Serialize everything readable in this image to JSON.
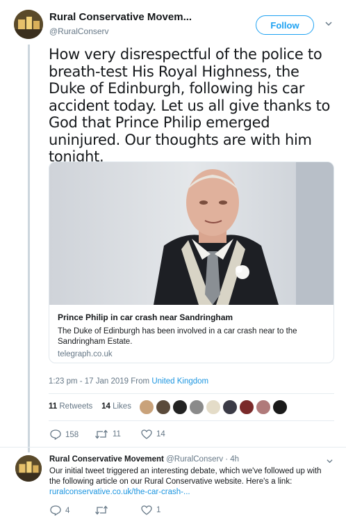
{
  "main_tweet": {
    "author_name": "Rural Conservative Movem...",
    "author_handle": "@RuralConserv",
    "follow_label": "Follow",
    "text": "How very disrespectful of the police to breath-test His Royal Highness, the Duke of Edinburgh, following his car accident today. Let us all give thanks to God that Prince Philip emerged uninjured. Our thoughts are with him tonight.",
    "card": {
      "title": "Prince Philip in car crash near Sandringham",
      "description": "The Duke of Edinburgh has been involved in a car crash near to the Sandringham Estate.",
      "domain": "telegraph.co.uk"
    },
    "timestamp": "1:23 pm - 17 Jan 2019 From",
    "location": "United Kingdom",
    "retweets_count": "11",
    "retweets_label": "Retweets",
    "likes_count": "14",
    "likes_label": "Likes",
    "actions": {
      "replies": "158",
      "retweets": "11",
      "likes": "14"
    }
  },
  "reply_tweet": {
    "author_name": "Rural Conservative Movement",
    "author_handle": "@RuralConserv · 4h",
    "text": "Our initial tweet triggered an interesting debate, which we've followed up with the following article on our Rural Conservative website. Here's a link:",
    "link": "ruralconservative.co.uk/the-car-crash-...",
    "actions": {
      "replies": "4",
      "retweets": "",
      "likes": "1"
    }
  },
  "colors": {
    "accent": "#1da1f2",
    "like_red": "#e0245e",
    "muted": "#657786"
  },
  "icons": [
    "reply-icon",
    "retweet-icon",
    "heart-icon",
    "chevron-down-icon"
  ]
}
